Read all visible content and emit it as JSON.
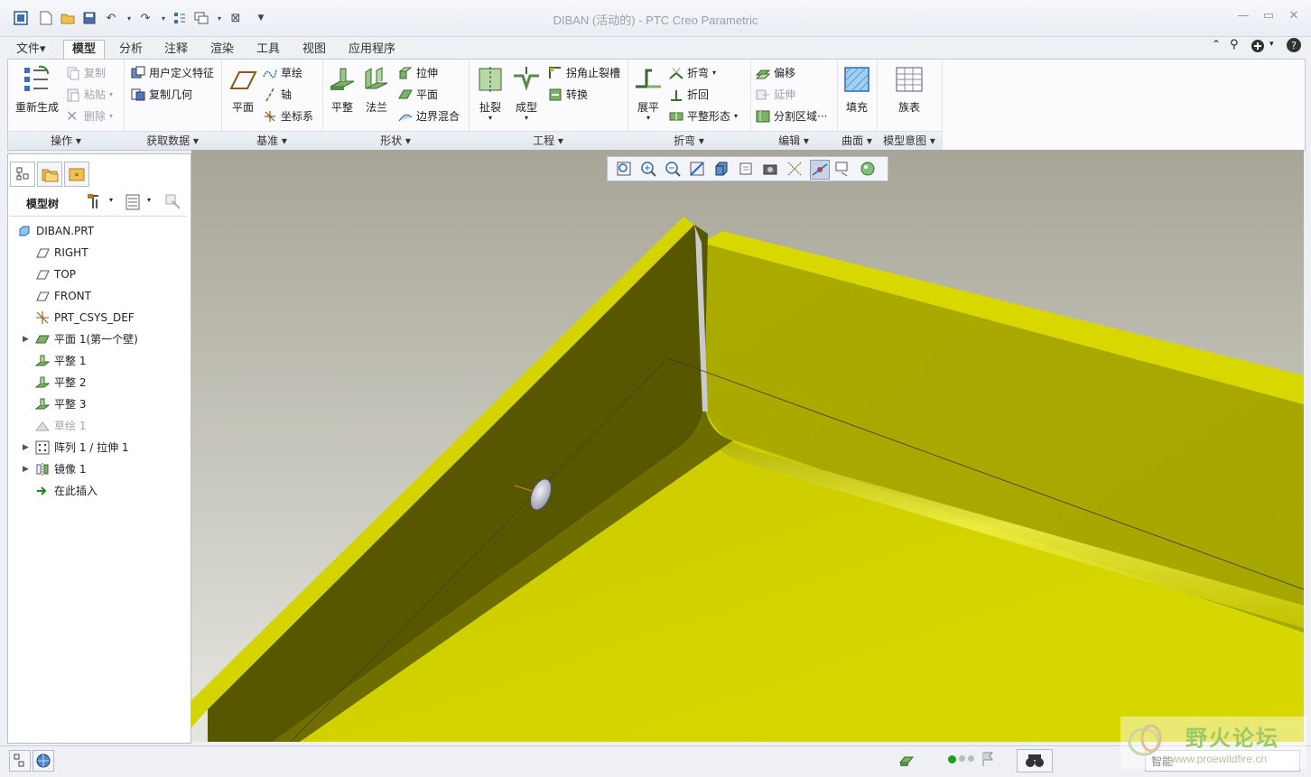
{
  "window": {
    "title": "DIBAN (活动的) - PTC Creo Parametric"
  },
  "tabs": [
    {
      "label": "文件▾"
    },
    {
      "label": "模型"
    },
    {
      "label": "分析"
    },
    {
      "label": "注释"
    },
    {
      "label": "渲染"
    },
    {
      "label": "工具"
    },
    {
      "label": "视图"
    },
    {
      "label": "应用程序"
    }
  ],
  "ribbon": {
    "operations": {
      "regen": "重新生成",
      "copy": "复制",
      "paste": "粘贴",
      "delete": "删除",
      "footer": "操作"
    },
    "getdata": {
      "udf": "用户定义特征",
      "copygeom": "复制几何",
      "footer": "获取数据"
    },
    "datum": {
      "plane": "平面",
      "sketch": "草绘",
      "axis": "轴",
      "csys": "坐标系",
      "footer": "基准"
    },
    "shapes": {
      "flat": "平整",
      "flange": "法兰",
      "extrude": "拉伸",
      "planar": "平面",
      "blend": "边界混合",
      "footer": "形状"
    },
    "engineering": {
      "rip": "扯裂",
      "form": "成型",
      "corner": "拐角止裂槽",
      "convert": "转换",
      "footer": "工程"
    },
    "bends": {
      "unbend": "展平",
      "bend": "折弯",
      "bendback": "折回",
      "flatstate": "平整形态",
      "footer": "折弯"
    },
    "editing": {
      "offset": "偏移",
      "extend": "延伸",
      "split": "分割区域···",
      "footer": "编辑"
    },
    "surfaces": {
      "fill": "填充",
      "footer": "曲面"
    },
    "intent": {
      "family": "族表",
      "footer": "模型意图"
    }
  },
  "leftpanel": {
    "header": "模型树",
    "tree": [
      {
        "label": "DIBAN.PRT",
        "icon": "part-icon",
        "indent": 0,
        "expand": false,
        "disabled": false
      },
      {
        "label": "RIGHT",
        "icon": "datum-plane-icon",
        "indent": 1,
        "expand": false,
        "disabled": false
      },
      {
        "label": "TOP",
        "icon": "datum-plane-icon",
        "indent": 1,
        "expand": false,
        "disabled": false
      },
      {
        "label": "FRONT",
        "icon": "datum-plane-icon",
        "indent": 1,
        "expand": false,
        "disabled": false
      },
      {
        "label": "PRT_CSYS_DEF",
        "icon": "csys-icon",
        "indent": 1,
        "expand": false,
        "disabled": false
      },
      {
        "label": "平面 1(第一个壁)",
        "icon": "flat-wall-icon",
        "indent": 1,
        "expand": true,
        "disabled": false
      },
      {
        "label": "平整 1",
        "icon": "flat-icon",
        "indent": 1,
        "expand": false,
        "disabled": false
      },
      {
        "label": "平整 2",
        "icon": "flat-icon",
        "indent": 1,
        "expand": false,
        "disabled": false
      },
      {
        "label": "平整 3",
        "icon": "flat-icon",
        "indent": 1,
        "expand": false,
        "disabled": false
      },
      {
        "label": "草绘 1",
        "icon": "sketch-icon",
        "indent": 1,
        "expand": false,
        "disabled": true
      },
      {
        "label": "阵列 1 / 拉伸 1",
        "icon": "pattern-icon",
        "indent": 1,
        "expand": true,
        "disabled": false
      },
      {
        "label": "镜像 1",
        "icon": "mirror-icon",
        "indent": 1,
        "expand": true,
        "disabled": false
      },
      {
        "label": "在此插入",
        "icon": "insert-arrow-icon",
        "indent": 1,
        "expand": false,
        "disabled": false
      }
    ]
  },
  "statusbar": {
    "filter": "智能"
  },
  "watermark": {
    "text": "野火论坛",
    "url": "www.proewildfire.cn"
  },
  "colors": {
    "model_yellow": "#d4d400",
    "model_shadow": "#575700",
    "bg_top": "#a7a597",
    "bg_bottom": "#e6e6e0"
  }
}
